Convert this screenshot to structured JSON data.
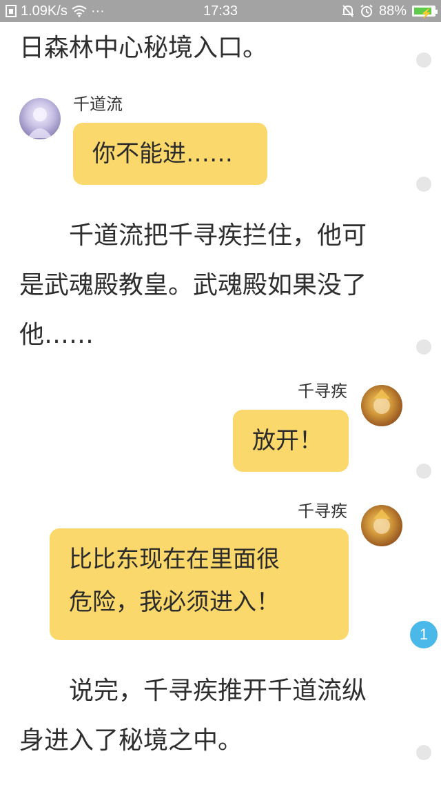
{
  "status_bar": {
    "speed": "1.09K/s",
    "more": "···",
    "time": "17:33",
    "battery": "88%",
    "battery_level": 0.88
  },
  "story": {
    "line_top": "日森林中心秘境入口。",
    "para1_line1": "千道流把千寻疾拦住，他可",
    "para1_line2": "是武魂殿教皇。武魂殿如果没了",
    "para1_line3": "他……",
    "para2_line1": "说完，千寻疾推开千道流纵",
    "para2_line2": "身进入了秘境之中。"
  },
  "dialogs": [
    {
      "speaker": "千道流",
      "lines": [
        "你不能进……"
      ]
    },
    {
      "speaker": "千寻疾",
      "lines": [
        "放开！"
      ]
    },
    {
      "speaker": "千寻疾",
      "lines": [
        "比比东现在在里面很",
        "危险，我必须进入！"
      ]
    }
  ],
  "comment_badge": "1"
}
